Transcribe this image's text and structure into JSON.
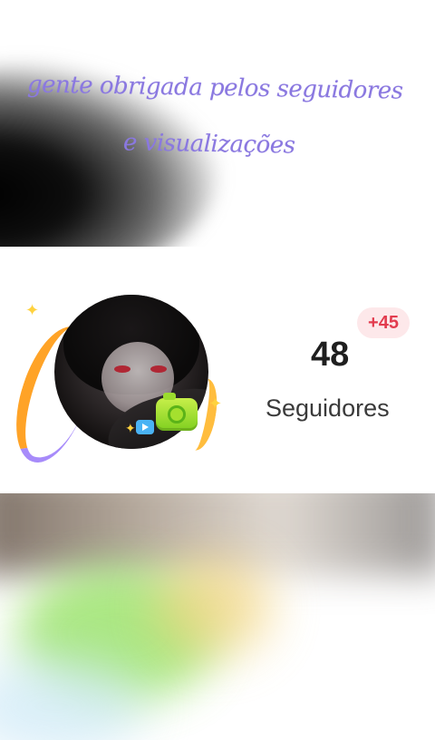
{
  "caption": {
    "line1": "gente obrigada pelos seguidores",
    "line2": "e visualizações"
  },
  "profile": {
    "followers_count": "48",
    "followers_increase": "+45",
    "followers_label": "Seguidores"
  },
  "colors": {
    "caption_text": "#8a78e0",
    "badge_text": "#e23b4e",
    "badge_bg": "#fde8ea",
    "count_text": "#1f1f1f"
  },
  "icons": [
    "sparkle-icon",
    "camera-icon",
    "play-icon"
  ]
}
